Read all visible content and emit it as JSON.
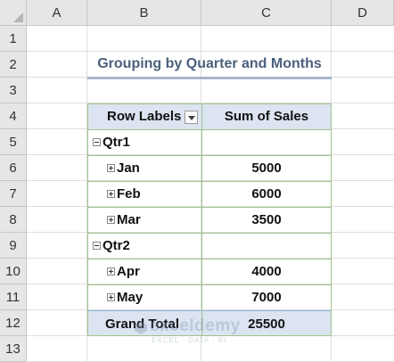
{
  "columns": [
    "A",
    "B",
    "C",
    "D"
  ],
  "rows": [
    "1",
    "2",
    "3",
    "4",
    "5",
    "6",
    "7",
    "8",
    "9",
    "10",
    "11",
    "12",
    "13"
  ],
  "title": "Grouping by Quarter and Months",
  "pivot": {
    "header_label": "Row Labels",
    "header_value": "Sum of Sales",
    "q1_label": "Qtr1",
    "jan_label": "Jan",
    "jan_value": "5000",
    "feb_label": "Feb",
    "feb_value": "6000",
    "mar_label": "Mar",
    "mar_value": "3500",
    "q2_label": "Qtr2",
    "apr_label": "Apr",
    "apr_value": "4000",
    "may_label": "May",
    "may_value": "7000",
    "total_label": "Grand Total",
    "total_value": "25500"
  },
  "watermark": {
    "name": "exceldemy",
    "tagline": "EXCEL · DATA · BI"
  },
  "colors": {
    "title": "#4a607c",
    "header_fill": "#dce4f1",
    "table_border": "#9fc38a"
  }
}
